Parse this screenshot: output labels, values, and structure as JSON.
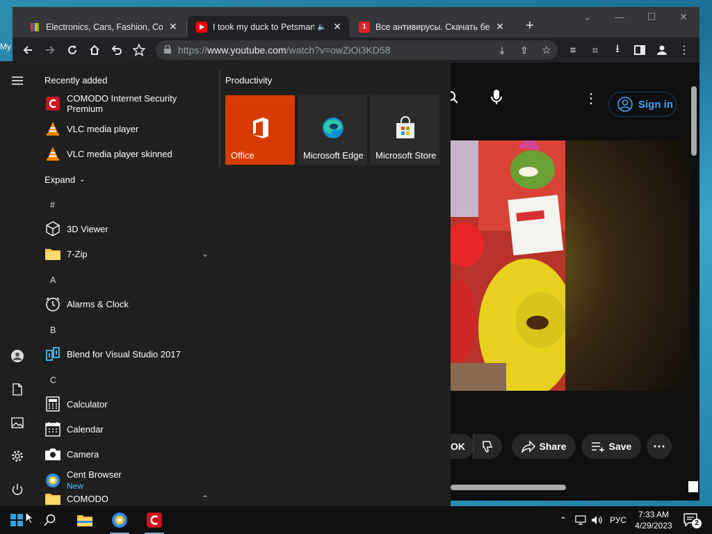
{
  "desktop": {
    "label": "My"
  },
  "browser": {
    "tabs": [
      {
        "title": "Electronics, Cars, Fashion, Collectibles",
        "favicon": "ebay-icon",
        "active": false
      },
      {
        "title": "I took my duck to Petsmart",
        "favicon": "youtube-icon",
        "active": true,
        "audio": true
      },
      {
        "title": "Все антивирусы. Скачать бесплатно",
        "favicon": "antivirus-icon",
        "active": false
      }
    ],
    "url_prefix": "https://",
    "url_host": "www.youtube.com",
    "url_path": "/watch?v=owZiOi3KD58"
  },
  "youtube": {
    "sign_in": "Sign in",
    "like_label": "OK",
    "share_label": "Share",
    "save_label": "Save"
  },
  "start_menu": {
    "recently_added_title": "Recently added",
    "recently_added": [
      {
        "name": "COMODO Internet Security Premium",
        "icon": "comodo-icon"
      },
      {
        "name": "VLC media player",
        "icon": "vlc-icon"
      },
      {
        "name": "VLC media player skinned",
        "icon": "vlc-icon"
      }
    ],
    "expand_label": "Expand",
    "groups": [
      {
        "letter": "#",
        "apps": [
          {
            "name": "3D Viewer",
            "icon": "cube-icon"
          },
          {
            "name": "7-Zip",
            "icon": "folder-icon"
          }
        ]
      },
      {
        "letter": "A",
        "apps": [
          {
            "name": "Alarms & Clock",
            "icon": "clock-icon"
          }
        ]
      },
      {
        "letter": "B",
        "apps": [
          {
            "name": "Blend for Visual Studio 2017",
            "icon": "blend-icon"
          }
        ]
      },
      {
        "letter": "C",
        "apps": [
          {
            "name": "Calculator",
            "icon": "calculator-icon"
          },
          {
            "name": "Calendar",
            "icon": "calendar-icon"
          },
          {
            "name": "Camera",
            "icon": "camera-icon"
          },
          {
            "name": "Cent Browser",
            "icon": "cent-browser-icon",
            "badge": "New"
          },
          {
            "name": "COMODO",
            "icon": "folder-icon"
          }
        ]
      }
    ],
    "tiles_title": "Productivity",
    "tiles": [
      {
        "name": "Office",
        "color": "#d83b01"
      },
      {
        "name": "Microsoft Edge",
        "color": "#2b2b2b"
      },
      {
        "name": "Microsoft Store",
        "color": "#2b2b2b"
      }
    ]
  },
  "taskbar": {
    "language": "РУС",
    "time": "7:33 AM",
    "date": "4/29/2023",
    "notification_count": "2"
  }
}
